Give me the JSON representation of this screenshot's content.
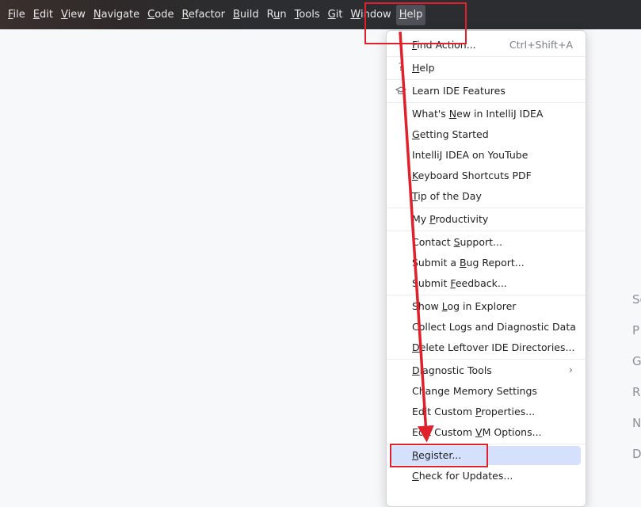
{
  "menubar": {
    "items": [
      {
        "pre": "",
        "u": "F",
        "post": "ile"
      },
      {
        "pre": "",
        "u": "E",
        "post": "dit"
      },
      {
        "pre": "",
        "u": "V",
        "post": "iew"
      },
      {
        "pre": "",
        "u": "N",
        "post": "avigate"
      },
      {
        "pre": "",
        "u": "C",
        "post": "ode"
      },
      {
        "pre": "",
        "u": "R",
        "post": "efactor"
      },
      {
        "pre": "",
        "u": "B",
        "post": "uild"
      },
      {
        "pre": "R",
        "u": "u",
        "post": "n"
      },
      {
        "pre": "",
        "u": "T",
        "post": "ools"
      },
      {
        "pre": "",
        "u": "G",
        "post": "it"
      },
      {
        "pre": "",
        "u": "W",
        "post": "indow"
      },
      {
        "pre": "",
        "u": "H",
        "post": "elp"
      }
    ]
  },
  "help_menu": {
    "find_action": {
      "pre": "",
      "u": "F",
      "post": "ind Action...",
      "shortcut": "Ctrl+Shift+A"
    },
    "help": {
      "pre": "",
      "u": "H",
      "post": "elp",
      "icon": "question-icon"
    },
    "learn": {
      "label": "Learn IDE Features",
      "icon": "graduation-cap-icon"
    },
    "whats_new": {
      "pre": "What's ",
      "u": "N",
      "post": "ew in IntelliJ IDEA"
    },
    "getting_started": {
      "pre": "",
      "u": "G",
      "post": "etting Started"
    },
    "youtube": {
      "label": "IntelliJ IDEA on YouTube"
    },
    "keyboard_pdf": {
      "pre": "",
      "u": "K",
      "post": "eyboard Shortcuts PDF"
    },
    "tip": {
      "pre": "",
      "u": "T",
      "post": "ip of the Day"
    },
    "productivity": {
      "pre": "My ",
      "u": "P",
      "post": "roductivity"
    },
    "contact": {
      "pre": "Contact ",
      "u": "S",
      "post": "upport..."
    },
    "bug": {
      "pre": "Submit a ",
      "u": "B",
      "post": "ug Report..."
    },
    "feedback": {
      "pre": "Submit ",
      "u": "F",
      "post": "eedback..."
    },
    "show_log": {
      "pre": "Show ",
      "u": "L",
      "post": "og in Explorer"
    },
    "collect": {
      "label": "Collect Logs and Diagnostic Data"
    },
    "delete": {
      "pre": "",
      "u": "D",
      "post": "elete Leftover IDE Directories..."
    },
    "diag_tools": {
      "pre": "",
      "u": "D",
      "post": "iagnostic Tools",
      "arrow": "chevron-right-icon"
    },
    "memory": {
      "label": "Change Memory Settings"
    },
    "custom_props": {
      "pre": "Edit Custom ",
      "u": "P",
      "post": "roperties..."
    },
    "custom_vm": {
      "pre": "Edit Custom ",
      "u": "V",
      "post": "M Options..."
    },
    "register": {
      "pre": "",
      "u": "R",
      "post": "egister..."
    },
    "updates": {
      "pre": "",
      "u": "C",
      "post": "heck for Updates..."
    }
  },
  "side_letters": [
    "Se",
    "P",
    "G",
    "R",
    "N",
    "D"
  ],
  "annotation": {
    "color": "#e0202a"
  }
}
